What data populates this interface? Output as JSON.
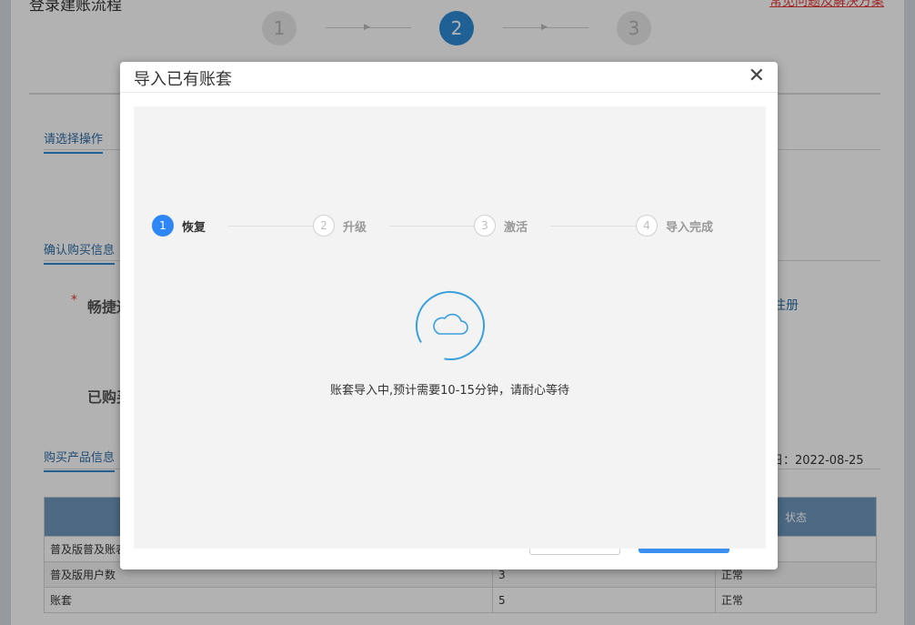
{
  "page": {
    "title": "登录建账流程",
    "help_link": "常见问题及解决方案",
    "wizard_steps": [
      "1",
      "2",
      "3"
    ],
    "sections": {
      "choose_operation": "请选择操作",
      "confirm_purchase": "确认购买信息",
      "purchased_products": "购买产品信息"
    },
    "field_label_1": "畅捷通",
    "field_label_2": "已购买",
    "register_link": "注册",
    "date_label": "日：2022-08-25"
  },
  "table": {
    "headers": [
      "",
      "",
      "状态"
    ],
    "rows": [
      {
        "name": "普及版普及账表",
        "count": "",
        "status": ""
      },
      {
        "name": "普及版用户数",
        "count": "3",
        "status": "正常"
      },
      {
        "name": "账套",
        "count": "5",
        "status": "正常"
      }
    ]
  },
  "modal": {
    "title": "导入已有账套",
    "close_symbol": "✕",
    "steps": [
      {
        "num": "1",
        "label": "恢复",
        "active": true
      },
      {
        "num": "2",
        "label": "升级",
        "active": false
      },
      {
        "num": "3",
        "label": "激活",
        "active": false
      },
      {
        "num": "4",
        "label": "导入完成",
        "active": false
      }
    ],
    "loading_icon": "cloud-icon",
    "loading_text": "账套导入中,预计需要10-15分钟，请耐心等待"
  },
  "colors": {
    "primary": "#2f86f6",
    "wizard_active": "#2f8bd6",
    "table_header": "#6f97bd",
    "link_red": "#e53935",
    "loader_ring": "#3aa0dc"
  }
}
